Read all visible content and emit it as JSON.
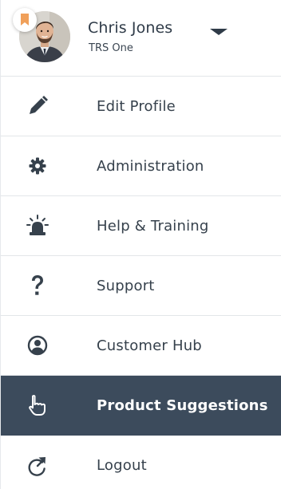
{
  "user": {
    "name": "Chris Jones",
    "org": "TRS One"
  },
  "menu": {
    "items": [
      {
        "label": "Edit Profile",
        "icon": "pencil-icon"
      },
      {
        "label": "Administration",
        "icon": "gear-icon"
      },
      {
        "label": "Help & Training",
        "icon": "alarm-light-icon"
      },
      {
        "label": "Support",
        "icon": "question-mark-icon"
      },
      {
        "label": "Customer Hub",
        "icon": "user-circle-icon"
      },
      {
        "label": "Product Suggestions",
        "icon": "pointing-hand-icon",
        "active": true
      },
      {
        "label": "Logout",
        "icon": "logout-arrow-icon"
      }
    ]
  },
  "colors": {
    "active_bg": "#3c4b5c",
    "text": "#36414c",
    "badge_accent": "#f0a05a"
  }
}
